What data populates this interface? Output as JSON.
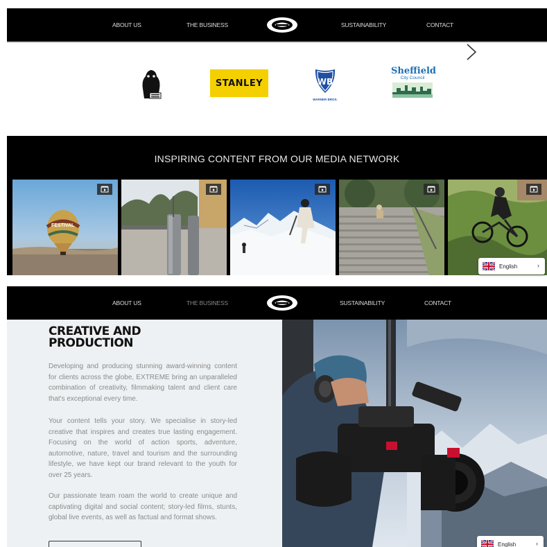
{
  "nav_top": {
    "about": "ABOUT US",
    "business": "THE BUSINESS",
    "sustainability": "SUSTAINABILITY",
    "contact": "CONTACT"
  },
  "logos": {
    "stanley": "STANLEY",
    "sheffield_name": "Sheffield",
    "sheffield_sub": "City Council",
    "wb_sub": "WARNER BROS."
  },
  "media": {
    "title": "INSPIRING CONTENT FROM OUR MEDIA NETWORK",
    "thumbs": [
      {
        "name": "hot-air-balloon",
        "overlay_text": "FESTIVAL"
      },
      {
        "name": "street-bollards"
      },
      {
        "name": "skiers-snow"
      },
      {
        "name": "stairs-park"
      },
      {
        "name": "mountain-bike"
      }
    ]
  },
  "language": {
    "label": "English"
  },
  "nav_bottom": {
    "about": "ABOUT US",
    "business": "THE BUSINESS",
    "sustainability": "SUSTAINABILITY",
    "contact": "CONTACT"
  },
  "creative": {
    "title_line1": "CREATIVE AND",
    "title_line2": "PRODUCTION",
    "para1": "Developing and producing stunning award-winning content for clients across the globe, EXTREME bring an unparalleled combination of creativity, filmmaking talent and client care that's exceptional every time.",
    "para2": "Your content tells your story. We specialise in story-led creative that inspires and creates true lasting engagement. Focusing on the world of action sports, adventure, automotive, nature, travel and tourism and the surrounding lifestyle, we have kept our brand relevant to the youth for over 25 years.",
    "para3": "Our passionate team roam the world to create unique and captivating digital and social content; story-led films, stunts, global live events, as well as factual and format shows."
  },
  "colors": {
    "nav_bg": "#000000",
    "stanley_yellow": "#f5d000",
    "wb_blue": "#1f4fa3",
    "sheffield_blue": "#1e6fb3",
    "panel_bg": "#eef1f3"
  }
}
